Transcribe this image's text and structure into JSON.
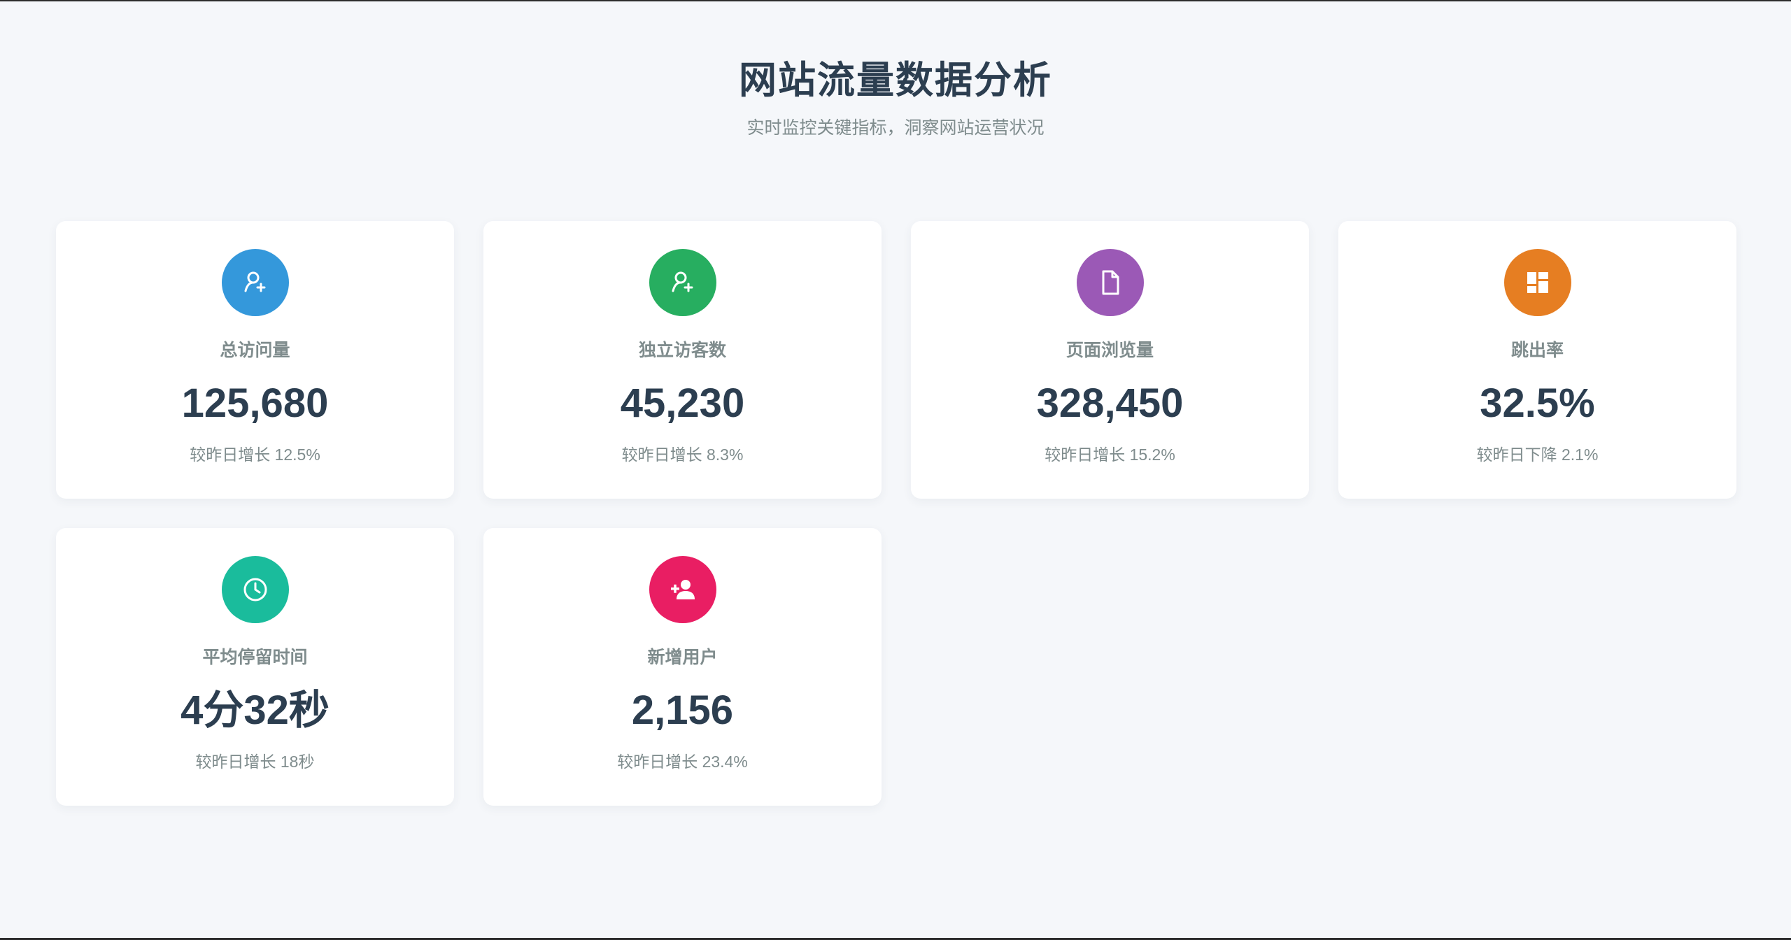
{
  "header": {
    "title": "网站流量数据分析",
    "subtitle": "实时监控关键指标，洞察网站运营状况"
  },
  "cards": [
    {
      "icon": "user-plus-icon",
      "color": "#3498db",
      "label": "总访问量",
      "value": "125,680",
      "change": "较昨日增长 12.5%"
    },
    {
      "icon": "user-plus-icon",
      "color": "#27ae60",
      "label": "独立访客数",
      "value": "45,230",
      "change": "较昨日增长 8.3%"
    },
    {
      "icon": "document-icon",
      "color": "#9b59b6",
      "label": "页面浏览量",
      "value": "328,450",
      "change": "较昨日增长 15.2%"
    },
    {
      "icon": "dashboard-icon",
      "color": "#e67e22",
      "label": "跳出率",
      "value": "32.5%",
      "change": "较昨日下降 2.1%"
    },
    {
      "icon": "clock-icon",
      "color": "#1abc9c",
      "label": "平均停留时间",
      "value": "4分32秒",
      "change": "较昨日增长 18秒"
    },
    {
      "icon": "add-user-icon",
      "color": "#e91e63",
      "label": "新增用户",
      "value": "2,156",
      "change": "较昨日增长 23.4%"
    }
  ]
}
